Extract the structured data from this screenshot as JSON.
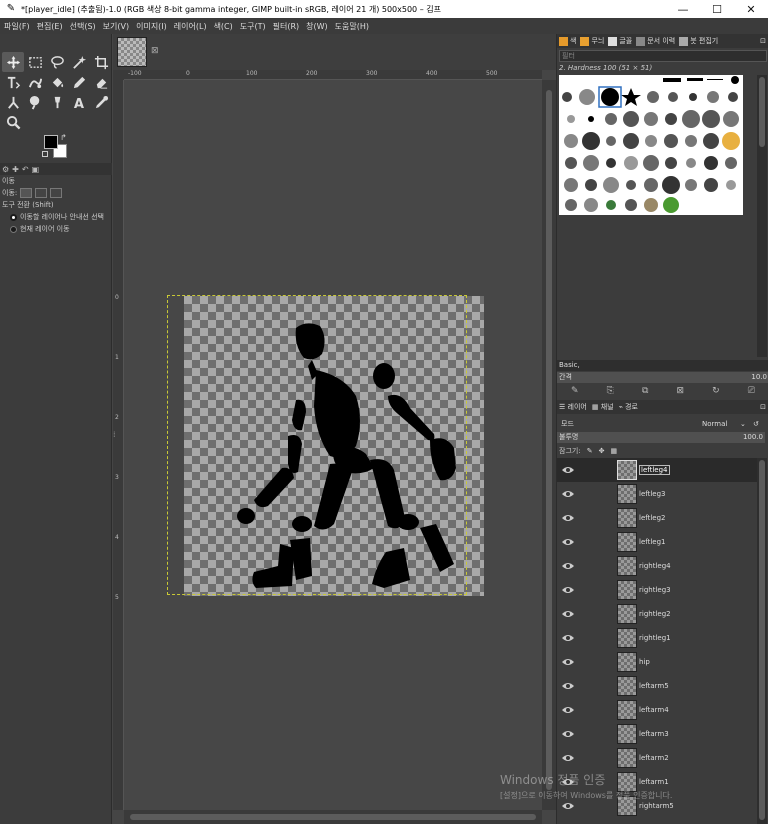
{
  "window": {
    "title": "*[player_idle] (추출됨)-1.0 (RGB 색상 8-bit gamma integer, GIMP built-in sRGB, 레이어 21 개) 500x500 – 김프",
    "minimize": "—",
    "maximize": "☐",
    "close": "✕"
  },
  "menu": [
    "파일(F)",
    "편집(E)",
    "선택(S)",
    "보기(V)",
    "이미지(I)",
    "레이어(L)",
    "색(C)",
    "도구(T)",
    "필터(R)",
    "창(W)",
    "도움말(H)"
  ],
  "tool_options": {
    "tab_label": "이동",
    "move_label": "이동:",
    "toggle_label": "도구 전환 (Shift)",
    "option1": "이동할 레이어나 안내선 선택",
    "option2": "현재 레이어 이동"
  },
  "rulers": {
    "h_ticks": [
      "-100",
      "0",
      "100",
      "200",
      "300",
      "400",
      "500"
    ],
    "v_ticks": [
      "0",
      "1",
      "2",
      "3",
      "4",
      "5"
    ]
  },
  "brushes": {
    "tab_colors": "색",
    "tab_patterns": "무늬",
    "tab_gradients": "글꼴",
    "tab_history": "문서 이력",
    "tab_brushes": "붓 편집기",
    "filter_placeholder": "필터",
    "selected_name": "2. Hardness 100 (51 × 51)",
    "preset": "Basic,",
    "spacing_label": "간격",
    "spacing_value": "10.0"
  },
  "layers_panel": {
    "tab_layers": "레이어",
    "tab_channels": "채널",
    "tab_paths": "경로",
    "mode_label": "모드",
    "mode_value": "Normal",
    "opacity_label": "불투명",
    "opacity_value": "100.0",
    "lock_label": "잠그기:",
    "layers": [
      "leftleg4",
      "leftleg3",
      "leftleg2",
      "leftleg1",
      "rightleg4",
      "rightleg3",
      "rightleg2",
      "rightleg1",
      "hip",
      "leftarm5",
      "leftarm4",
      "leftarm3",
      "leftarm2",
      "leftarm1",
      "rightarm5"
    ],
    "selected_index": 0
  },
  "watermark": {
    "line1": "Windows 정품 인증",
    "line2": "[설정]으로 이동하여 Windows를 정품 인증합니다."
  },
  "colors": {
    "foreground": "#000000",
    "background": "#ffffff"
  }
}
